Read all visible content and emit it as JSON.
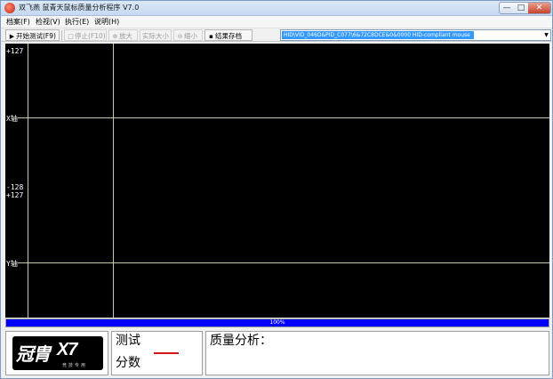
{
  "window": {
    "title": "双飞燕 鼠青天鼠标质量分析程序 V7.0",
    "minimize_glyph": "—",
    "maximize_glyph": "□",
    "close_glyph": "✕"
  },
  "menu": {
    "items": [
      {
        "label": "档案(F)"
      },
      {
        "label": "检视(V)"
      },
      {
        "label": "执行(E)"
      },
      {
        "label": "说明(H)"
      }
    ]
  },
  "toolbar": {
    "start": {
      "label": "开始测试(F9)",
      "icon": "play-icon",
      "glyph": "▶"
    },
    "stop": {
      "label": "停止(F10)",
      "icon": "stop-icon",
      "glyph": "□"
    },
    "zoom_in": {
      "label": "放大",
      "icon": "zoom-in-icon",
      "glyph": "⊕"
    },
    "actual_size": {
      "label": "实际大小"
    },
    "zoom_out": {
      "label": "缩小",
      "icon": "zoom-out-icon",
      "glyph": "⊖"
    },
    "save": {
      "label": "结果存档",
      "icon": "save-icon",
      "glyph": "▪"
    },
    "device": {
      "value": "HID\\VID_046D&PID_C077\\6&72C8DCE&0&0000     HID-compliant mouse",
      "arrow": "▼"
    }
  },
  "plot": {
    "x_axis": {
      "max": "+127",
      "min": "-128",
      "label": "X轴"
    },
    "y_axis": {
      "max": "+127",
      "label": "Y轴"
    }
  },
  "progress": {
    "text": "100%",
    "value": 1.0
  },
  "bottom": {
    "logo": {
      "brand_cn": "冠胄",
      "brand_en": "X7",
      "sub": "竞技专用"
    },
    "score": {
      "line1": "测试",
      "line2": "分数"
    },
    "analysis": {
      "label": "质量分析："
    }
  },
  "colors": {
    "plot_bg": "#000000",
    "grid": "#c8c8b0",
    "progress": "#0000ff",
    "score_dash": "#d21414"
  }
}
